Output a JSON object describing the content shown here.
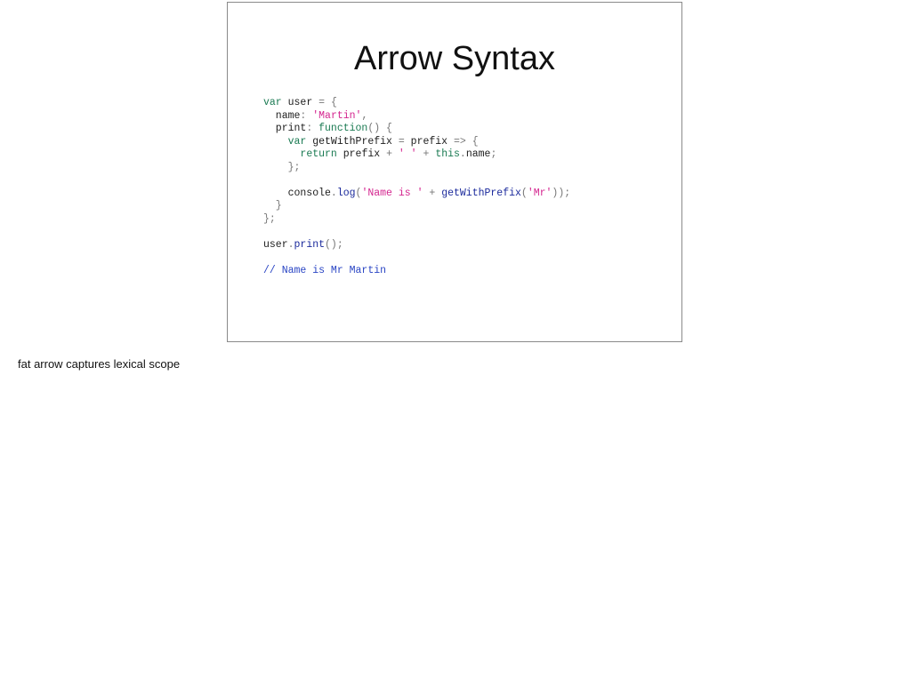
{
  "slide": {
    "title": "Arrow Syntax"
  },
  "colors": {
    "plain": "#1c1c1c",
    "keyword": "#1a7a52",
    "string": "#d4268f",
    "call": "#1b2a9c",
    "comment": "#2a45c4",
    "punct": "#777777"
  },
  "code": {
    "lines": [
      [
        {
          "t": "var",
          "k": "keyword"
        },
        {
          "t": " user ",
          "k": "plain"
        },
        {
          "t": "= {",
          "k": "punct"
        }
      ],
      [
        {
          "t": "  name",
          "k": "plain"
        },
        {
          "t": ": ",
          "k": "punct"
        },
        {
          "t": "'Martin'",
          "k": "string"
        },
        {
          "t": ",",
          "k": "punct"
        }
      ],
      [
        {
          "t": "  print",
          "k": "plain"
        },
        {
          "t": ": ",
          "k": "punct"
        },
        {
          "t": "function",
          "k": "keyword"
        },
        {
          "t": "() {",
          "k": "punct"
        }
      ],
      [
        {
          "t": "    ",
          "k": "plain"
        },
        {
          "t": "var",
          "k": "keyword"
        },
        {
          "t": " getWithPrefix ",
          "k": "plain"
        },
        {
          "t": "= ",
          "k": "punct"
        },
        {
          "t": "prefix ",
          "k": "plain"
        },
        {
          "t": "=> {",
          "k": "punct"
        }
      ],
      [
        {
          "t": "      ",
          "k": "plain"
        },
        {
          "t": "return",
          "k": "keyword"
        },
        {
          "t": " prefix ",
          "k": "plain"
        },
        {
          "t": "+ ",
          "k": "punct"
        },
        {
          "t": "' '",
          "k": "string"
        },
        {
          "t": " + ",
          "k": "punct"
        },
        {
          "t": "this",
          "k": "keyword"
        },
        {
          "t": ".",
          "k": "punct"
        },
        {
          "t": "name",
          "k": "plain"
        },
        {
          "t": ";",
          "k": "punct"
        }
      ],
      [
        {
          "t": "    };",
          "k": "punct"
        }
      ],
      [],
      [
        {
          "t": "    console",
          "k": "plain"
        },
        {
          "t": ".",
          "k": "punct"
        },
        {
          "t": "log",
          "k": "call"
        },
        {
          "t": "(",
          "k": "punct"
        },
        {
          "t": "'Name is '",
          "k": "string"
        },
        {
          "t": " + ",
          "k": "punct"
        },
        {
          "t": "getWithPrefix",
          "k": "call"
        },
        {
          "t": "(",
          "k": "punct"
        },
        {
          "t": "'Mr'",
          "k": "string"
        },
        {
          "t": "));",
          "k": "punct"
        }
      ],
      [
        {
          "t": "  }",
          "k": "punct"
        }
      ],
      [
        {
          "t": "};",
          "k": "punct"
        }
      ],
      [],
      [
        {
          "t": "user",
          "k": "plain"
        },
        {
          "t": ".",
          "k": "punct"
        },
        {
          "t": "print",
          "k": "call"
        },
        {
          "t": "();",
          "k": "punct"
        }
      ],
      [],
      [
        {
          "t": "// Name is Mr Martin",
          "k": "comment"
        }
      ]
    ]
  },
  "notes": {
    "text": "fat arrow captures lexical scope"
  }
}
